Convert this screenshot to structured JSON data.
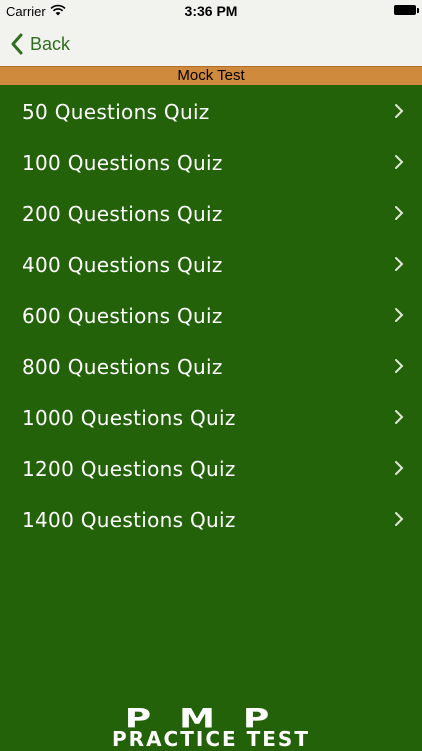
{
  "status_bar": {
    "carrier": "Carrier",
    "time": "3:36 PM"
  },
  "nav": {
    "back_label": "Back"
  },
  "section": {
    "title": "Mock Test"
  },
  "quizzes": [
    {
      "label": "50 Questions Quiz"
    },
    {
      "label": "100 Questions Quiz"
    },
    {
      "label": "200 Questions Quiz"
    },
    {
      "label": "400 Questions Quiz"
    },
    {
      "label": "600 Questions Quiz"
    },
    {
      "label": "800 Questions Quiz"
    },
    {
      "label": "1000 Questions Quiz"
    },
    {
      "label": "1200 Questions Quiz"
    },
    {
      "label": "1400 Questions Quiz"
    }
  ],
  "footer": {
    "logo_big": "PMP",
    "logo_small": "PRACTICE TEST"
  },
  "colors": {
    "background": "#236209",
    "header_bar": "#d08a3e",
    "nav_background": "#f2f3ee",
    "back_tint": "#2f6e1e"
  }
}
